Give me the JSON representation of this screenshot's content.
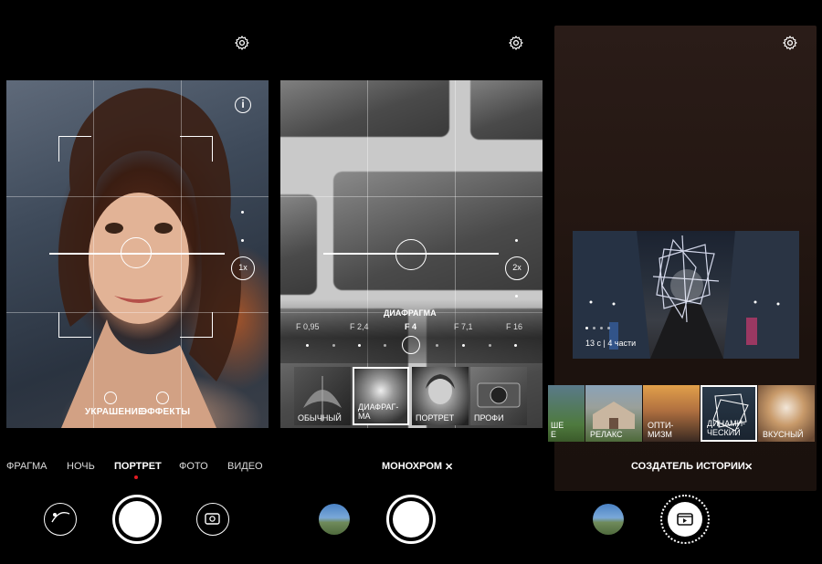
{
  "panel1": {
    "modes": [
      "ФРАГМА",
      "НОЧЬ",
      "ПОРТРЕТ",
      "ФОТО",
      "ВИДЕО"
    ],
    "active_mode": "ПОРТРЕТ",
    "zoom": "1x",
    "options": {
      "beauty": "УКРАШЕНИЕ",
      "effects": "ЭФФЕКТЫ"
    },
    "icons": [
      "gear-icon",
      "info-icon",
      "filter-icon",
      "camera-switch-icon"
    ]
  },
  "panel2": {
    "zoom": "2x",
    "aperture_title": "ДИАФРАГМА",
    "aperture_values": [
      "F 0,95",
      "F 2,4",
      "F 4",
      "F 7,1",
      "F 16"
    ],
    "aperture_selected": "F 4",
    "filters": [
      "ОБЫЧНЫЙ",
      "ДИАФРАГ-\nМА",
      "ПОРТРЕТ",
      "ПРОФИ"
    ],
    "selected_filter": "ДИАФРАГ-\nМА",
    "bottom_title": "МОНОХРОМ",
    "close": "✕"
  },
  "panel3": {
    "story_caption": "13 с | 4 части",
    "tiles": [
      "ШЕ\nЕ",
      "РЕЛАКС",
      "ОПТИ-\nМИЗМ",
      "ДИНАМИ-\nЧЕСКИЙ",
      "ВКУСНЫЙ"
    ],
    "selected_tile": "ДИНАМИ-\nЧЕСКИЙ",
    "bottom_title": "СОЗДАТЕЛЬ ИСТОРИИ",
    "close": "✕"
  },
  "colors": {
    "accent_red": "#e31b23",
    "background": "#000000"
  }
}
